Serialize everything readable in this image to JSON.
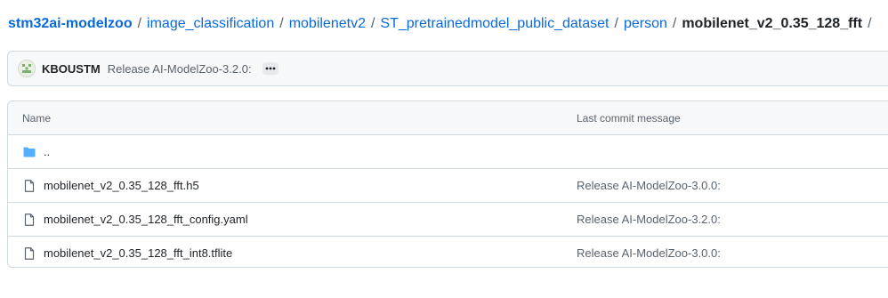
{
  "breadcrumb": {
    "root": "stm32ai-modelzoo",
    "parts": [
      "image_classification",
      "mobilenetv2",
      "ST_pretrainedmodel_public_dataset",
      "person"
    ],
    "current": "mobilenet_v2_0.35_128_fft",
    "separator": "/"
  },
  "latest_commit": {
    "author": "KBOUSTM",
    "message": "Release AI-ModelZoo-3.2.0:"
  },
  "table": {
    "headers": {
      "name": "Name",
      "last_commit": "Last commit message"
    },
    "rows": [
      {
        "name": "..",
        "type": "folder",
        "commit": ""
      },
      {
        "name": "mobilenet_v2_0.35_128_fft.h5",
        "type": "file",
        "commit": "Release AI-ModelZoo-3.0.0:"
      },
      {
        "name": "mobilenet_v2_0.35_128_fft_config.yaml",
        "type": "file",
        "commit": "Release AI-ModelZoo-3.2.0:"
      },
      {
        "name": "mobilenet_v2_0.35_128_fft_int8.tflite",
        "type": "file",
        "commit": "Release AI-ModelZoo-3.0.0:"
      }
    ]
  },
  "colors": {
    "link": "#0969da",
    "text": "#1f2328",
    "muted": "#59636e",
    "folder": "#54aeff",
    "border": "#d1d9e0"
  },
  "icons": {
    "copy": "copy-icon",
    "folder": "folder-icon",
    "file": "file-icon",
    "ellipsis": "kebab-horizontal-icon"
  }
}
